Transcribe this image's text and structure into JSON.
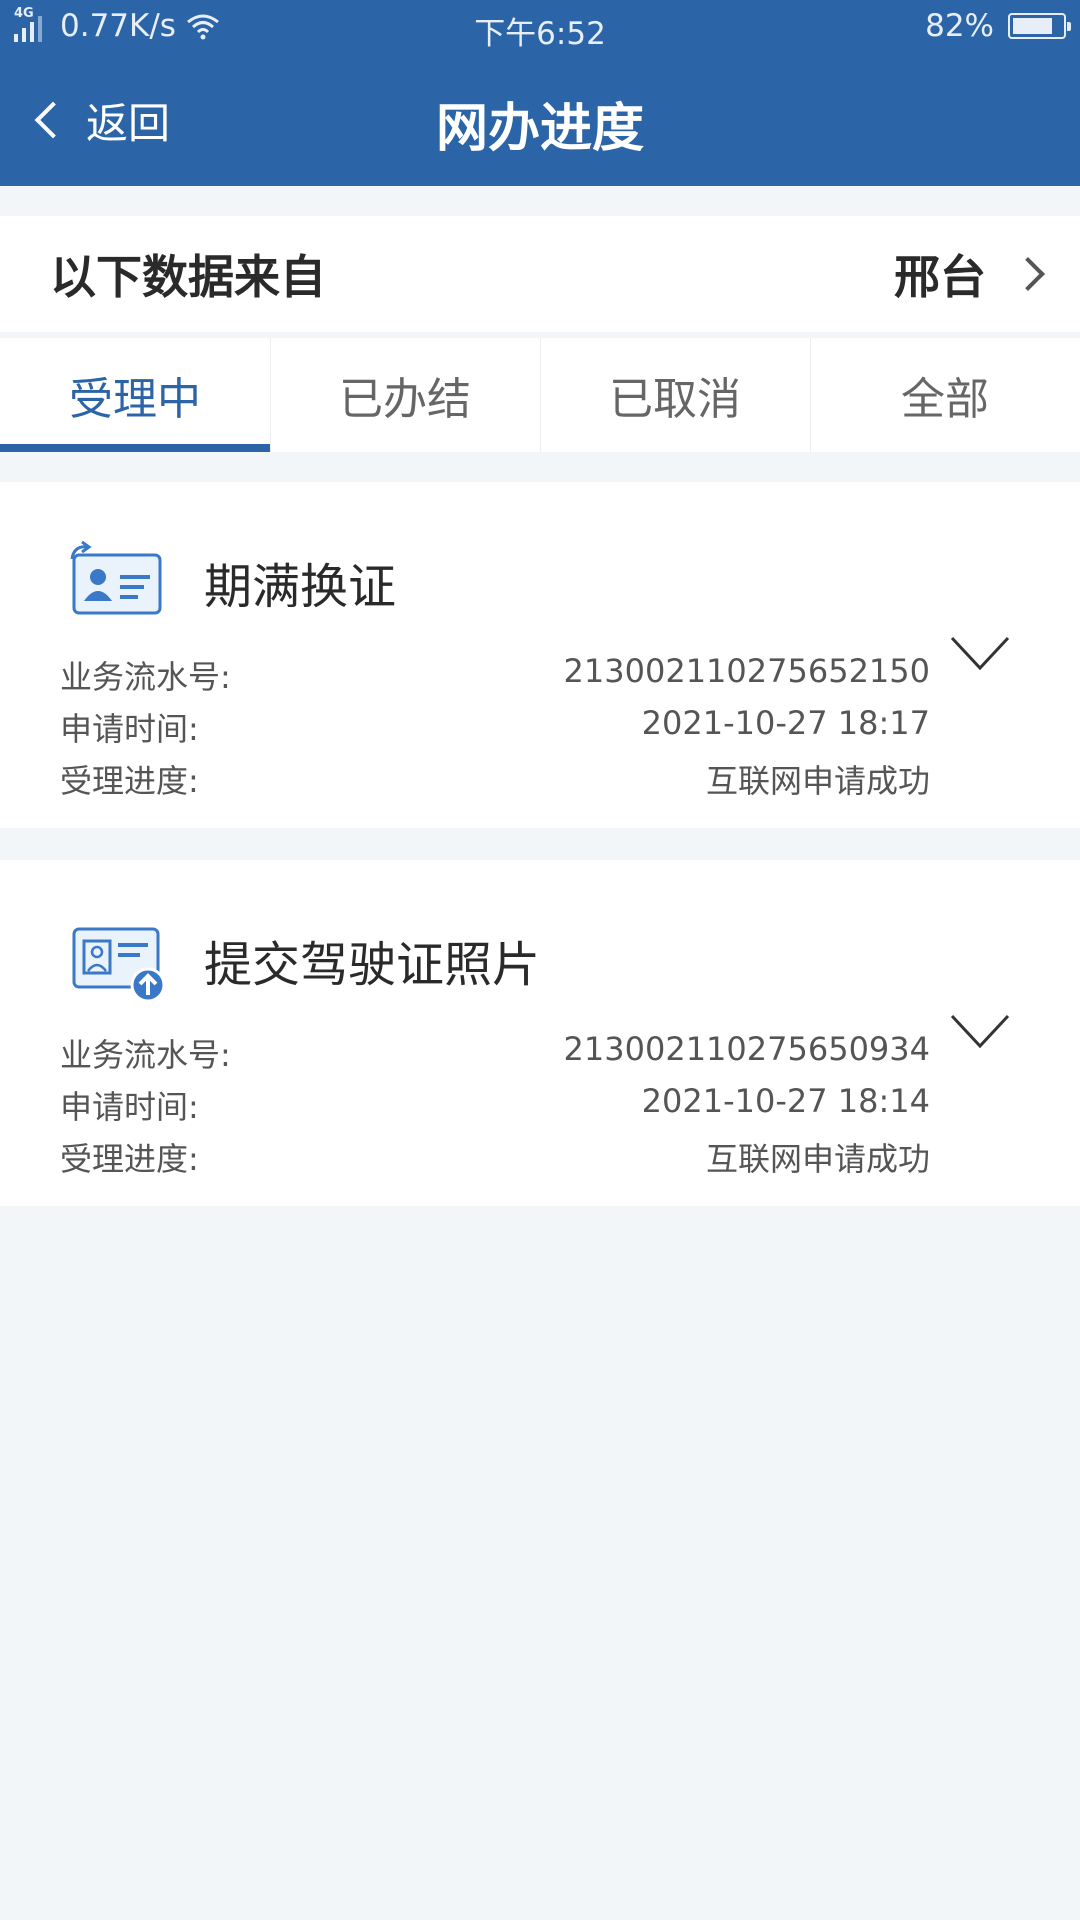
{
  "status_bar": {
    "network": "4G",
    "speed": "0.77K/s",
    "time": "下午6:52",
    "battery_text": "82%",
    "battery_level": 0.82
  },
  "nav": {
    "back_label": "返回",
    "title": "网办进度"
  },
  "source": {
    "label": "以下数据来自",
    "value": "邢台"
  },
  "tabs": [
    {
      "label": "受理中",
      "active": true
    },
    {
      "label": "已办结",
      "active": false
    },
    {
      "label": "已取消",
      "active": false
    },
    {
      "label": "全部",
      "active": false
    }
  ],
  "records": [
    {
      "icon": "id-card-renew-icon",
      "title": "期满换证",
      "rows": [
        {
          "label": "业务流水号:",
          "value": "213002110275652150"
        },
        {
          "label": "申请时间:",
          "value": "2021-10-27 18:17"
        },
        {
          "label": "受理进度:",
          "value": "互联网申请成功"
        }
      ]
    },
    {
      "icon": "photo-upload-icon",
      "title": "提交驾驶证照片",
      "rows": [
        {
          "label": "业务流水号:",
          "value": "213002110275650934"
        },
        {
          "label": "申请时间:",
          "value": "2021-10-27 18:14"
        },
        {
          "label": "受理进度:",
          "value": "互联网申请成功"
        }
      ]
    }
  ],
  "colors": {
    "brand_blue": "#2c64a8",
    "page_bg": "#f3f6f8"
  }
}
